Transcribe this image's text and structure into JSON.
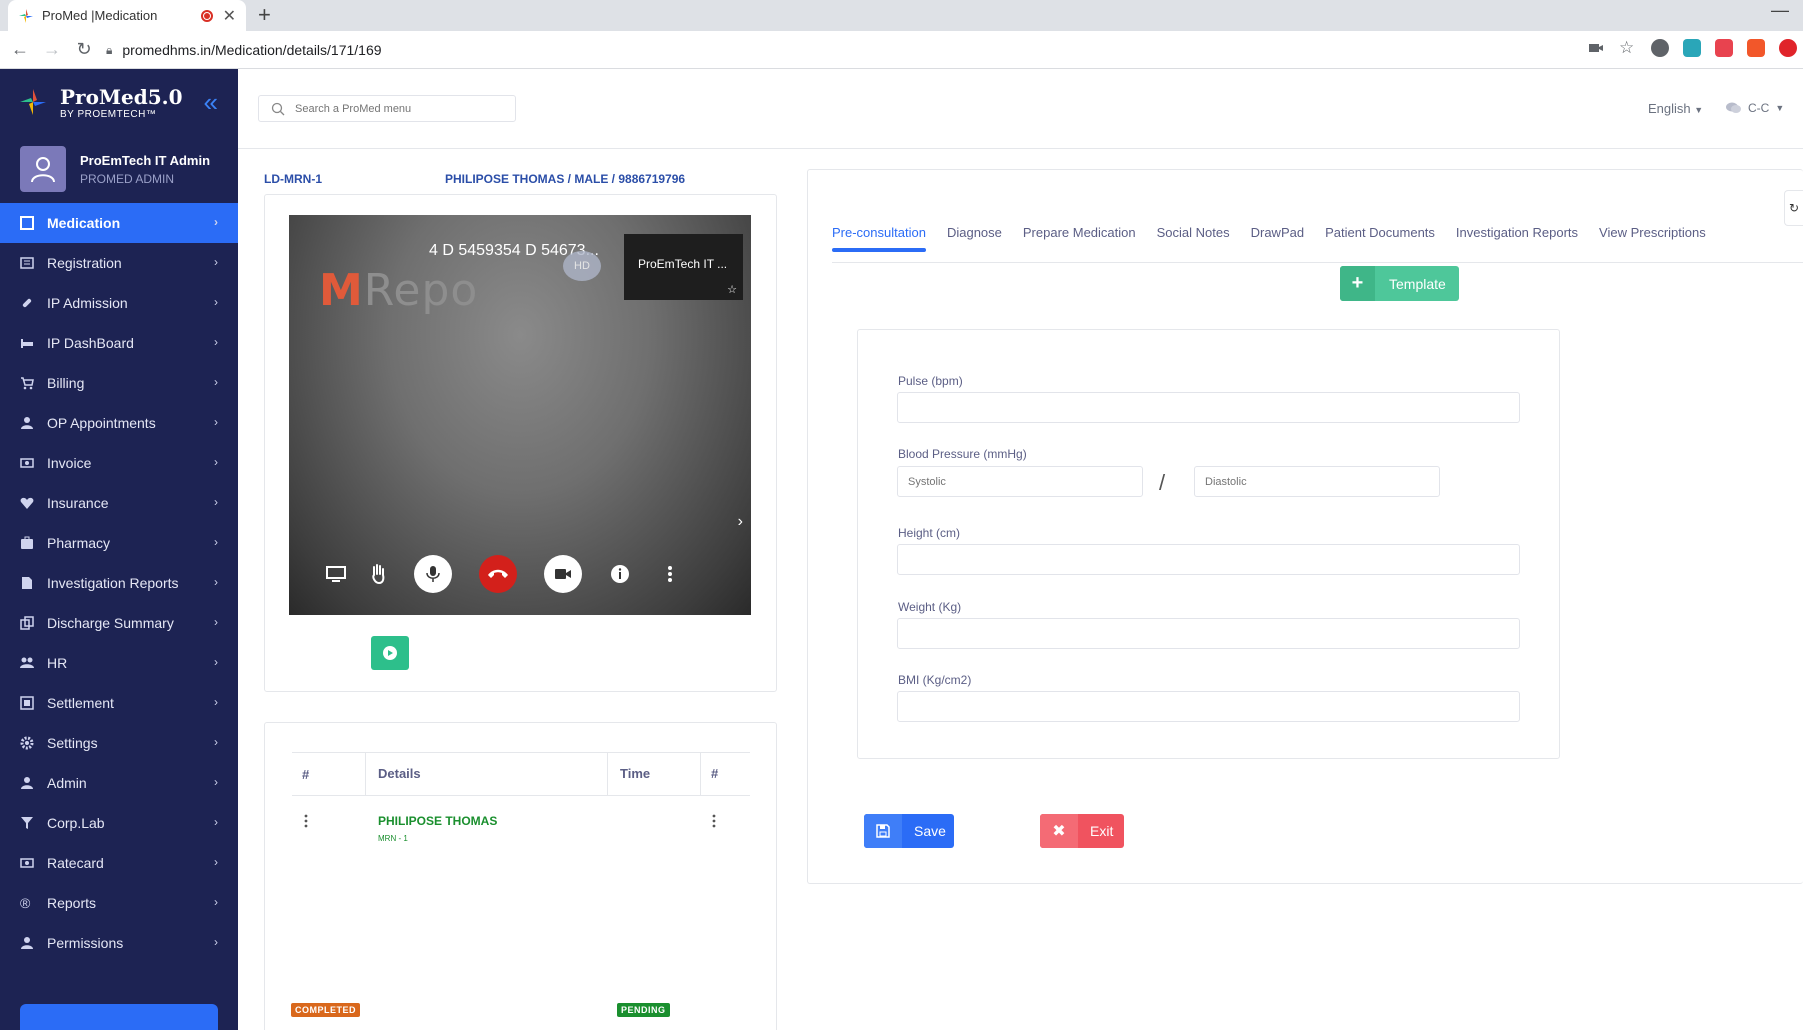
{
  "browser": {
    "tab_title": "ProMed |Medication",
    "url": "promedhms.in/Medication/details/171/169",
    "new_tab": "+",
    "close": "✕"
  },
  "sidebar": {
    "brand_name": "ProMed5.0",
    "brand_by": "BY PROEMTECH™",
    "user_name": "ProEmTech IT Admin",
    "user_role": "PROMED ADMIN",
    "items": [
      {
        "label": "Medication",
        "icon": "square-icon"
      },
      {
        "label": "Registration",
        "icon": "list-icon"
      },
      {
        "label": "IP Admission",
        "icon": "pill-icon"
      },
      {
        "label": "IP DashBoard",
        "icon": "bed-icon"
      },
      {
        "label": "Billing",
        "icon": "cart-icon"
      },
      {
        "label": "OP Appointments",
        "icon": "user-md-icon"
      },
      {
        "label": "Invoice",
        "icon": "money-icon"
      },
      {
        "label": "Insurance",
        "icon": "heartbeat-icon"
      },
      {
        "label": "Pharmacy",
        "icon": "medkit-icon"
      },
      {
        "label": "Investigation Reports",
        "icon": "file-icon"
      },
      {
        "label": "Discharge Summary",
        "icon": "copy-icon"
      },
      {
        "label": "HR",
        "icon": "users-icon"
      },
      {
        "label": "Settlement",
        "icon": "balance-icon"
      },
      {
        "label": "Settings",
        "icon": "gear-icon"
      },
      {
        "label": "Admin",
        "icon": "user-icon"
      },
      {
        "label": "Corp.Lab",
        "icon": "filter-icon"
      },
      {
        "label": "Ratecard",
        "icon": "card-icon"
      },
      {
        "label": "Reports",
        "icon": "registered-icon"
      },
      {
        "label": "Permissions",
        "icon": "user-icon"
      }
    ]
  },
  "header": {
    "search_placeholder": "Search a ProMed menu",
    "language": "English",
    "user_short": "C-C"
  },
  "patient": {
    "mrn": "LD-MRN-1",
    "info": "PHILIPOSE THOMAS / MALE / 9886719796"
  },
  "video": {
    "caption": "4 D 5459354 D 54673...",
    "hd": "HD",
    "watermark": "Repo",
    "participant": "ProEmTech IT ...",
    "star": "☆"
  },
  "queue": {
    "headers": [
      "#",
      "Details",
      "Time",
      "#"
    ],
    "rows": [
      {
        "name": "PHILIPOSE THOMAS",
        "mrn": "MRN - 1"
      }
    ],
    "status_left": "COMPLETED",
    "status_right": "PENDING"
  },
  "tabs": [
    "Pre-consultation",
    "Diagnose",
    "Prepare Medication",
    "Social Notes",
    "DrawPad",
    "Patient Documents",
    "Investigation Reports",
    "View Prescriptions"
  ],
  "form": {
    "template_label": "Template",
    "pulse_label": "Pulse (bpm)",
    "bp_label": "Blood Pressure (mmHg)",
    "systolic_placeholder": "Systolic",
    "diastolic_placeholder": "Diastolic",
    "slash": "/",
    "height_label": "Height (cm)",
    "weight_label": "Weight (Kg)",
    "bmi_label": "BMI (Kg/cm2)",
    "save_label": "Save",
    "exit_label": "Exit"
  },
  "colors": {
    "sidebar_bg": "#1d2353",
    "accent": "#2b6cf6",
    "template_green": "#4ec79a",
    "exit_red": "#f0535f",
    "completed": "#d9681c",
    "pending": "#1a8f2e"
  }
}
